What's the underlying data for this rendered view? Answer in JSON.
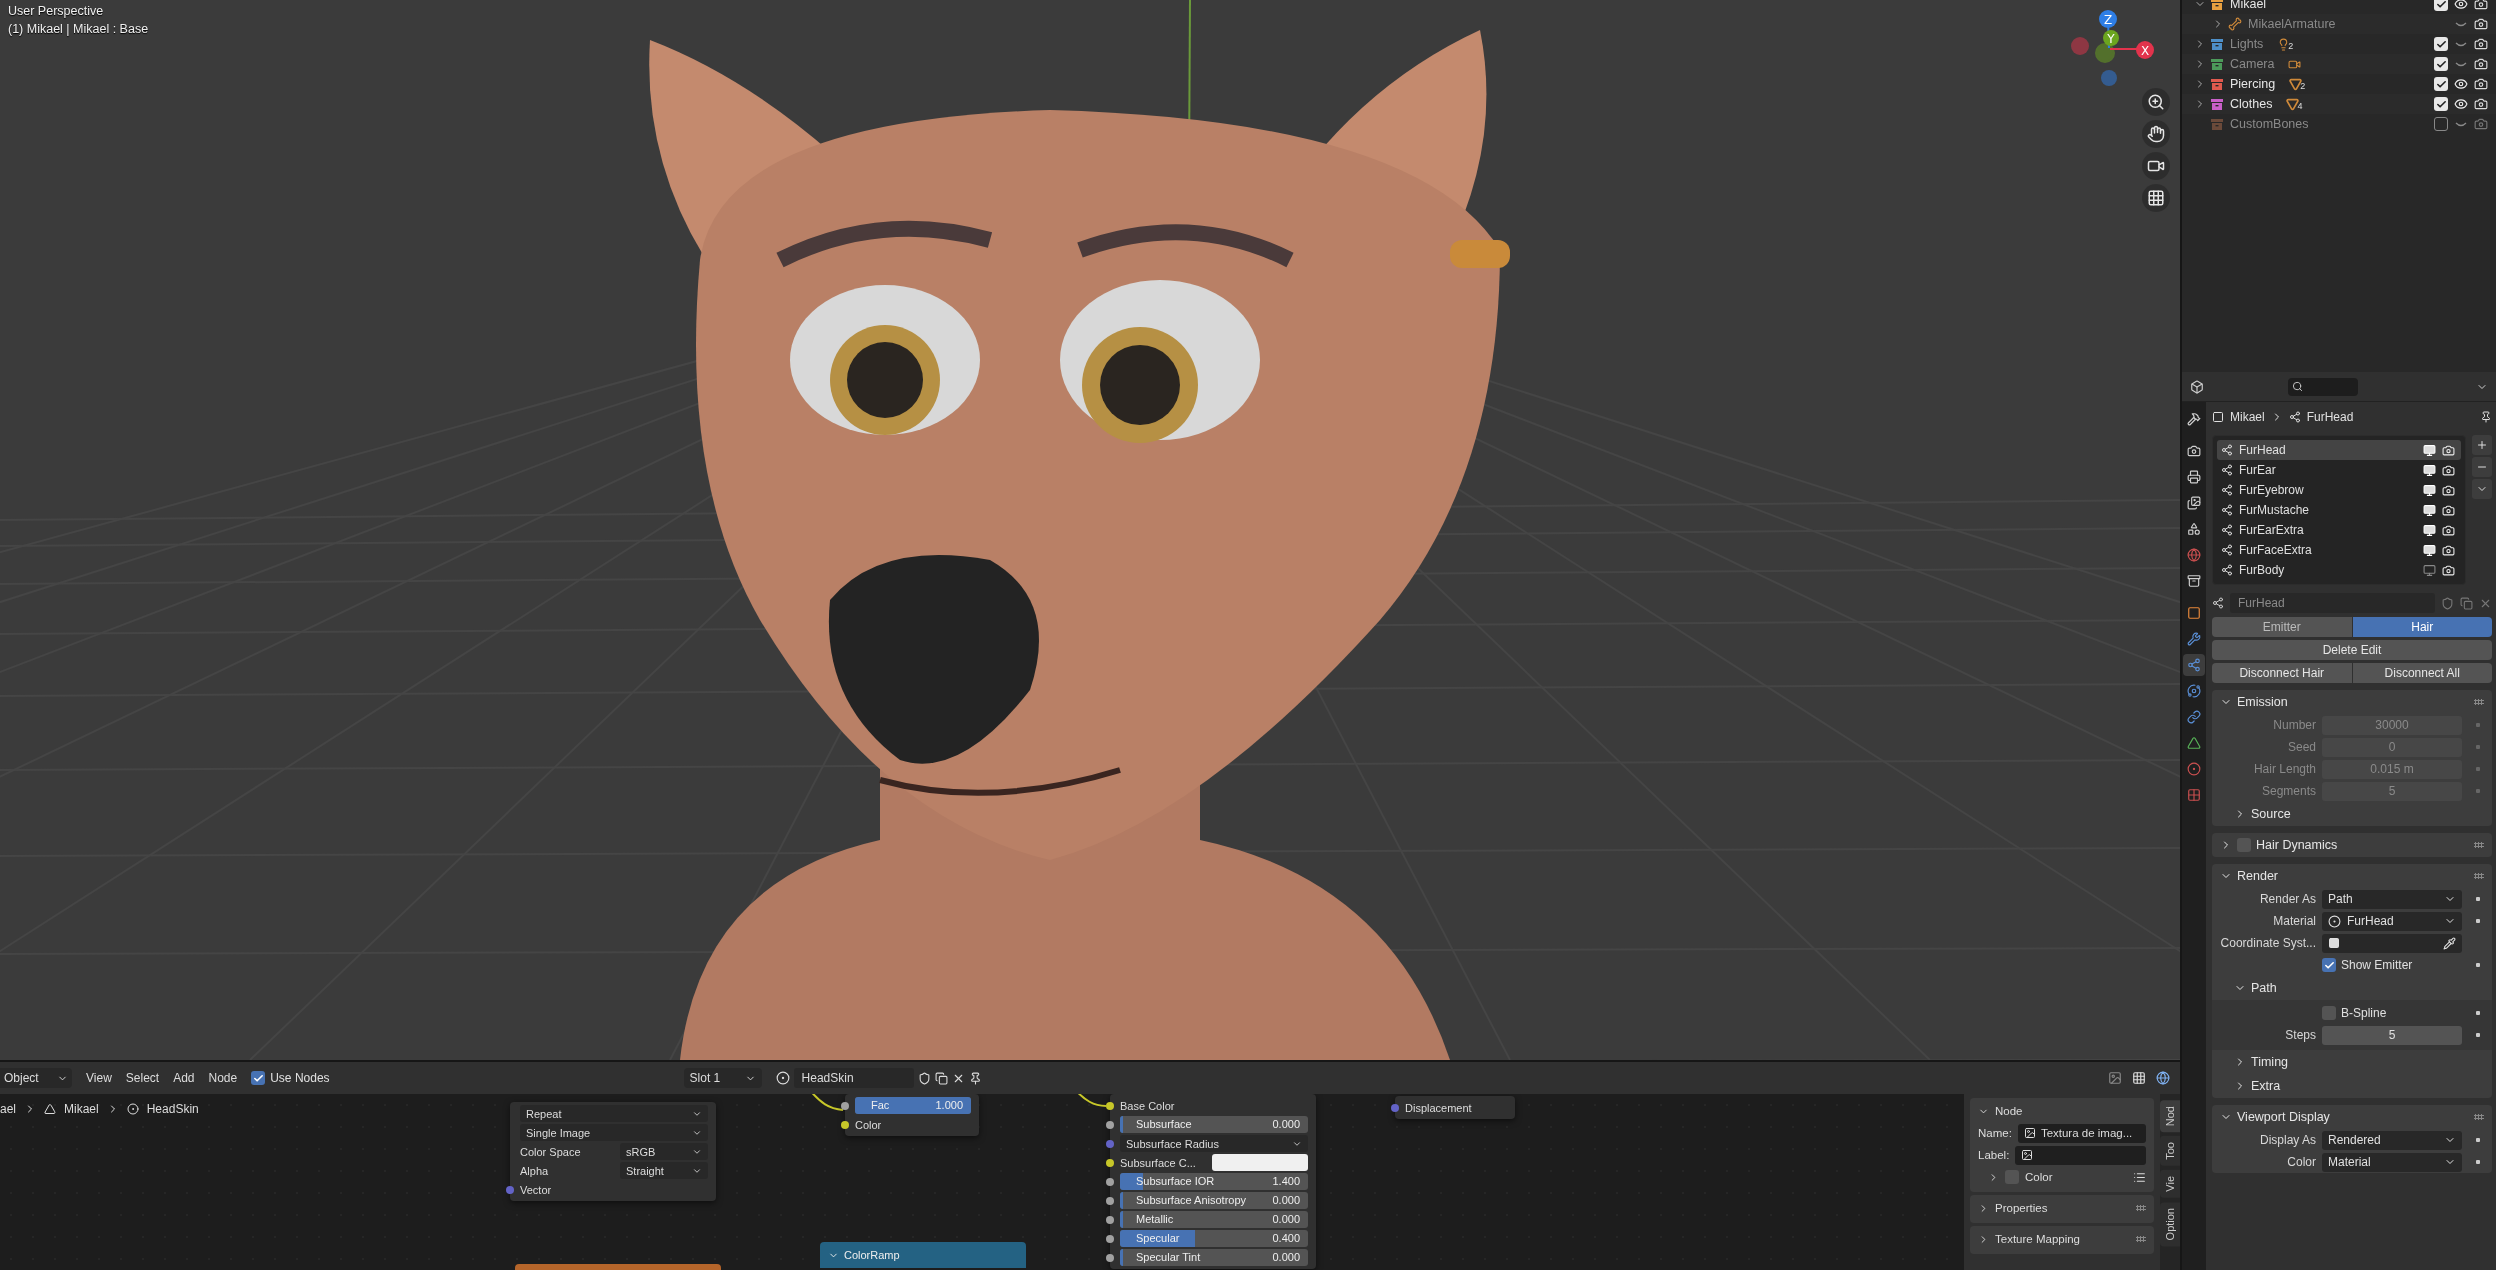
{
  "viewport": {
    "mode": "User Perspective",
    "info": "(1) Mikael | Mikael : Base",
    "axes": [
      {
        "label": "Z",
        "color": "#2e7ee6"
      },
      {
        "label": "Y",
        "color": "#6ba51f"
      },
      {
        "label": "X",
        "color": "#e2334c"
      }
    ]
  },
  "outliner": {
    "rows": [
      {
        "name": "Mikael",
        "kind": "collection",
        "color": "#e8a040",
        "expanded": true,
        "checked": true,
        "visible": true,
        "children": [
          {
            "name": "MikaelArmature",
            "kind": "armature",
            "expanded": false,
            "visible": false
          }
        ]
      },
      {
        "name": "Lights",
        "kind": "collection",
        "color": "#4e8fc8",
        "expanded": false,
        "checked": true,
        "visible": false,
        "content": {
          "kind": "light",
          "count": "2"
        }
      },
      {
        "name": "Camera",
        "kind": "collection",
        "color": "#4c9a5a",
        "expanded": false,
        "checked": true,
        "visible": false,
        "content": {
          "kind": "camera"
        }
      },
      {
        "name": "Piercing",
        "kind": "collection",
        "color": "#e05a4e",
        "expanded": false,
        "checked": true,
        "visible": true,
        "content": {
          "kind": "mesh",
          "count": "2"
        }
      },
      {
        "name": "Clothes",
        "kind": "collection",
        "color": "#c95fc8",
        "expanded": false,
        "checked": true,
        "visible": true,
        "content": {
          "kind": "mesh",
          "count": "4"
        }
      },
      {
        "name": "CustomBones",
        "kind": "collection",
        "color": "#6b4a3a",
        "checked": false,
        "visible": false
      }
    ]
  },
  "properties": {
    "tabs": [
      {
        "kind": "tool",
        "selected": false
      },
      {
        "kind": "render",
        "selected": false
      },
      {
        "kind": "output",
        "selected": false
      },
      {
        "kind": "view-layer",
        "selected": false
      },
      {
        "kind": "scene",
        "selected": false
      },
      {
        "kind": "world",
        "selected": false
      },
      {
        "kind": "collection",
        "selected": false
      },
      {
        "kind": "object",
        "selected": false
      },
      {
        "kind": "modifier",
        "selected": false
      },
      {
        "kind": "particles",
        "selected": true
      },
      {
        "kind": "physics",
        "selected": false
      },
      {
        "kind": "constraints",
        "selected": false
      },
      {
        "kind": "data",
        "selected": false
      },
      {
        "kind": "material",
        "selected": false
      },
      {
        "kind": "texture",
        "selected": false
      }
    ],
    "breadcrumb": [
      "Mikael",
      "FurHead"
    ],
    "systems": [
      {
        "name": "FurHead",
        "selected": true,
        "viewport": true
      },
      {
        "name": "FurEar",
        "selected": false,
        "viewport": true
      },
      {
        "name": "FurEyebrow",
        "selected": false,
        "viewport": true
      },
      {
        "name": "FurMustache",
        "selected": false,
        "viewport": true
      },
      {
        "name": "FurEarExtra",
        "selected": false,
        "viewport": true
      },
      {
        "name": "FurFaceExtra",
        "selected": false,
        "viewport": true
      },
      {
        "name": "FurBody",
        "selected": false,
        "viewport": false
      }
    ],
    "settings_name": "FurHead",
    "type_tabs": [
      {
        "label": "Emitter",
        "selected": false
      },
      {
        "label": "Hair",
        "selected": true
      }
    ],
    "button_rows": [
      [
        "Delete Edit"
      ],
      [
        "Disconnect Hair",
        "Disconnect All"
      ]
    ],
    "panels": [
      {
        "title": "Emission",
        "expanded": true,
        "rows": [
          {
            "kind": "number",
            "label": "Number",
            "value": "30000",
            "disabled": true
          },
          {
            "kind": "number",
            "label": "Seed",
            "value": "0",
            "disabled": true
          },
          {
            "kind": "number",
            "label": "Hair Length",
            "value": "0.015 m",
            "disabled": true
          },
          {
            "kind": "number",
            "label": "Segments",
            "value": "5",
            "disabled": true
          }
        ],
        "subpanels": [
          {
            "title": "Source",
            "expanded": false
          }
        ]
      },
      {
        "title": "Hair Dynamics",
        "expanded": false,
        "checked": false
      },
      {
        "title": "Render",
        "expanded": true,
        "rows": [
          {
            "kind": "select",
            "label": "Render As",
            "value": "Path"
          },
          {
            "kind": "material",
            "label": "Material",
            "value": "FurHead"
          },
          {
            "kind": "object",
            "label": "Coordinate Syst..."
          },
          {
            "kind": "checkbox",
            "label": "Show Emitter",
            "checked": true
          }
        ],
        "subpanels": [
          {
            "title": "Path",
            "expanded": true,
            "rows": [
              {
                "kind": "checkbox",
                "label": "B-Spline",
                "checked": false
              },
              {
                "kind": "number",
                "label": "Steps",
                "value": "5"
              }
            ]
          },
          {
            "title": "Timing",
            "expanded": false
          },
          {
            "title": "Extra",
            "expanded": false
          }
        ]
      },
      {
        "title": "Viewport Display",
        "expanded": true,
        "rows": [
          {
            "kind": "select",
            "label": "Display As",
            "value": "Rendered"
          },
          {
            "kind": "select",
            "label": "Color",
            "value": "Material"
          }
        ]
      }
    ]
  },
  "node_editor": {
    "header": {
      "mode": "Object",
      "menus": [
        "View",
        "Select",
        "Add",
        "Node"
      ],
      "use_nodes": {
        "label": "Use Nodes",
        "checked": true
      },
      "slot": "Slot 1",
      "material": "HeadSkin"
    },
    "breadcrumb": [
      "ael",
      "Mikael",
      "HeadSkin"
    ],
    "nodes": [
      {
        "kind": "image-texture",
        "rows": [
          {
            "kind": "select",
            "value": "Repeat"
          },
          {
            "kind": "select",
            "value": "Single Image"
          },
          {
            "kind": "select",
            "label": "Color Space",
            "value": "sRGB"
          },
          {
            "kind": "select",
            "label": "Alpha",
            "value": "Straight"
          },
          {
            "kind": "socket",
            "label": "Vector",
            "color": "#6363c7"
          }
        ]
      },
      {
        "kind": "mix",
        "rows": [
          {
            "kind": "slider",
            "label": "Fac",
            "value": "1.000",
            "level": 1,
            "color": "#a1a1a1"
          },
          {
            "kind": "socket",
            "label": "Color",
            "color": "#c7c729"
          }
        ]
      },
      {
        "kind": "principled",
        "rows": [
          {
            "kind": "socket",
            "label": "Base Color",
            "color": "#c7c729"
          },
          {
            "kind": "slider",
            "label": "Subsurface",
            "value": "0.000",
            "level": 0,
            "color": "#a1a1a1"
          },
          {
            "kind": "select",
            "value": "Subsurface Radius",
            "color": "#6363c7"
          },
          {
            "kind": "color",
            "label": "Subsurface C...",
            "color": "#c7c729"
          },
          {
            "kind": "slider",
            "label": "Subsurface IOR",
            "value": "1.400",
            "level": 0.12,
            "color": "#a1a1a1"
          },
          {
            "kind": "slider",
            "label": "Subsurface Anisotropy",
            "value": "0.000",
            "level": 0,
            "color": "#a1a1a1"
          },
          {
            "kind": "slider",
            "label": "Metallic",
            "value": "0.000",
            "level": 0,
            "color": "#a1a1a1"
          },
          {
            "kind": "slider",
            "label": "Specular",
            "value": "0.400",
            "level": 0.4,
            "color": "#a1a1a1"
          },
          {
            "kind": "slider",
            "label": "Specular Tint",
            "value": "0.000",
            "level": 0,
            "color": "#a1a1a1"
          }
        ]
      },
      {
        "kind": "output",
        "rows": [
          {
            "kind": "socket",
            "label": "Displacement",
            "color": "#6363c7"
          }
        ]
      },
      {
        "kind": "color-ramp",
        "title": "ColorRamp"
      }
    ],
    "sidebar": {
      "panel": "Node",
      "name_label": "Name:",
      "name_value": "Textura de imag...",
      "label_label": "Label:",
      "color": {
        "label": "Color",
        "expanded": false,
        "checked": false
      },
      "panels": [
        "Properties",
        "Texture Mapping"
      ]
    },
    "sidebar_tabs": [
      {
        "label": "Nod",
        "selected": true
      },
      {
        "label": "Too",
        "selected": false
      },
      {
        "label": "Vie",
        "selected": false
      },
      {
        "label": "Option",
        "selected": false
      }
    ]
  }
}
